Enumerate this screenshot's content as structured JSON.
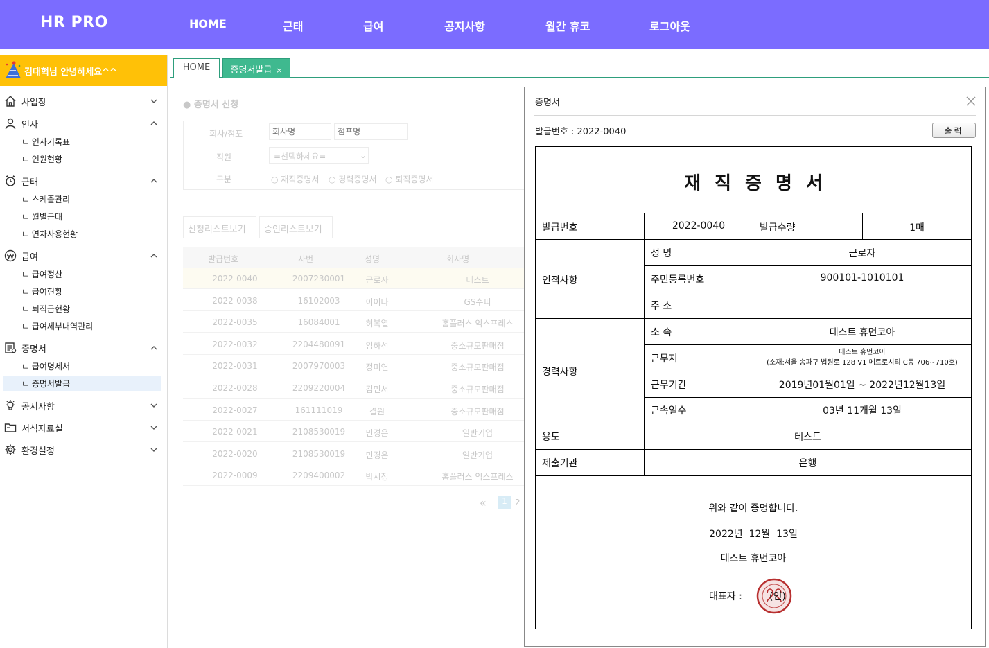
{
  "topbar": {
    "brand": "HR PRO",
    "nav": [
      "HOME",
      "근태",
      "급여",
      "공지사항",
      "월간 휴코",
      "로그아웃"
    ]
  },
  "sidebar": {
    "greeting": "김대혁님 안녕하세요^^",
    "menus": [
      {
        "label": "사업장",
        "icon": "home-icon",
        "open": false,
        "subs": []
      },
      {
        "label": "인사",
        "icon": "person-icon",
        "open": true,
        "subs": [
          "ㄴ 인사기록표",
          "ㄴ 인원현황"
        ]
      },
      {
        "label": "근태",
        "icon": "alarm-clock-icon",
        "open": true,
        "subs": [
          "ㄴ 스케줄관리",
          "ㄴ 월별근태",
          "ㄴ 연차사용현황"
        ]
      },
      {
        "label": "급여",
        "icon": "won-circle-icon",
        "open": true,
        "subs": [
          "ㄴ 급여정산",
          "ㄴ 급여현황",
          "ㄴ 퇴직금현황",
          "ㄴ 급여세부내역관리"
        ]
      },
      {
        "label": "증명서",
        "icon": "certificate-icon",
        "open": true,
        "subs": [
          "ㄴ 급여명세서",
          "ㄴ 증명서발급"
        ]
      },
      {
        "label": "공지사항",
        "icon": "lightbulb-icon",
        "open": false,
        "subs": []
      },
      {
        "label": "서식자료실",
        "icon": "folder-icon",
        "open": false,
        "subs": []
      },
      {
        "label": "환경설정",
        "icon": "gear-icon",
        "open": false,
        "subs": []
      }
    ],
    "active_sub": "ㄴ 증명서발급"
  },
  "tabs": [
    {
      "label": "HOME"
    },
    {
      "label": "증명서발급",
      "close": "×"
    }
  ],
  "background_form": {
    "section_title": "증명서 신청",
    "labels": {
      "company": "회사/점포",
      "staff": "직원",
      "type": "구분"
    },
    "placeholders": {
      "company": "회사명",
      "store": "점포명"
    },
    "select_value": "=선택하세요=",
    "radios": [
      "재직증명서",
      "경력증명서",
      "퇴직증명서"
    ],
    "buttons": [
      "신청리스트보기",
      "승인리스트보기"
    ],
    "columns": [
      "발급번호",
      "사번",
      "성명",
      "회사명"
    ],
    "rows": [
      [
        "2022-0040",
        "2007230001",
        "근로자",
        "테스트"
      ],
      [
        "2022-0038",
        "16102003",
        "이이나",
        "GS수퍼"
      ],
      [
        "2022-0035",
        "16084001",
        "허복열",
        "홈플러스 익스프레스"
      ],
      [
        "2022-0032",
        "2204480091",
        "임하선",
        "중소규모판매점"
      ],
      [
        "2022-0031",
        "2007970003",
        "정미연",
        "중소규모판매점"
      ],
      [
        "2022-0028",
        "2209220004",
        "김민서",
        "중소규모판매점"
      ],
      [
        "2022-0027",
        "161111019",
        "결원",
        "중소규모판매점"
      ],
      [
        "2022-0021",
        "2108530019",
        "민경은",
        "일반기업"
      ],
      [
        "2022-0020",
        "2108530019",
        "민경은",
        "일반기업"
      ],
      [
        "2022-0009",
        "2209400002",
        "박시정",
        "홈플러스 익스프레스"
      ]
    ],
    "pagination": {
      "prev": "«",
      "current": "1",
      "next": "2"
    }
  },
  "modal": {
    "title": "증명서",
    "issue_line": "발급번호 : 2022-0040",
    "print_button": "출력",
    "certificate": {
      "heading": "재직증명서",
      "issue_no_label": "발급번호",
      "issue_no": "2022-0040",
      "qty_label": "발급수량",
      "qty": "1매",
      "personal_label": "인적사항",
      "name_label": "성 명",
      "name": "근로자",
      "rrn_label": "주민등록번호",
      "rrn": "900101-1010101",
      "address_label": "주 소",
      "address": "",
      "career_label": "경력사항",
      "dept_label": "소 속",
      "dept": "테스트 휴먼코아",
      "workplace_label": "근무지",
      "workplace_line1": "테스트 휴먼코아",
      "workplace_line2": "(소재:서울 송파구 법원로 128 V1 메트로시티 C동 706~710호)",
      "period_label": "근무기간",
      "period": "2019년01월01일 ~ 2022년12월13일",
      "days_label": "근속일수",
      "days": "03년 11개월 13일",
      "purpose_label": "용도",
      "purpose": "테스트",
      "submit_label": "제출기관",
      "submit_to": "은행",
      "statement": "위와 같이 증명합니다.",
      "date": "2022년  12월  13일",
      "company": "테스트 휴먼코아",
      "rep_label": "대표자 :",
      "seal_text": "(인)"
    }
  }
}
